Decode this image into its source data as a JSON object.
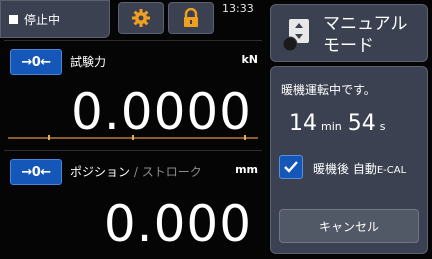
{
  "status": {
    "text": "停止中"
  },
  "header": {
    "time": "13:33",
    "gear_icon": "gear-icon",
    "lock_icon": "lock-icon"
  },
  "force_panel": {
    "zero_label": "→0←",
    "label": "試験力",
    "unit": "kN",
    "value": "0.0000"
  },
  "position_panel": {
    "zero_label": "→0←",
    "label": "ポジション",
    "label_sep": " / ",
    "label_alt": "ストローク",
    "unit": "mm",
    "value": "0.000"
  },
  "manual_mode": {
    "line1": "マニュアル",
    "line2": "モード"
  },
  "warmup": {
    "message": "暖機運転中です。",
    "minutes": "14",
    "min_unit": "min",
    "seconds": "54",
    "sec_unit": "s",
    "checkbox_checked": true,
    "checkbox_label": "暖機後 自動",
    "checkbox_label_small": "E-CAL",
    "cancel_label": "キャンセル"
  },
  "colors": {
    "accent_blue": "#1557b8",
    "panel_gray": "#3b4150",
    "scale_line": "#8a5c2e"
  }
}
